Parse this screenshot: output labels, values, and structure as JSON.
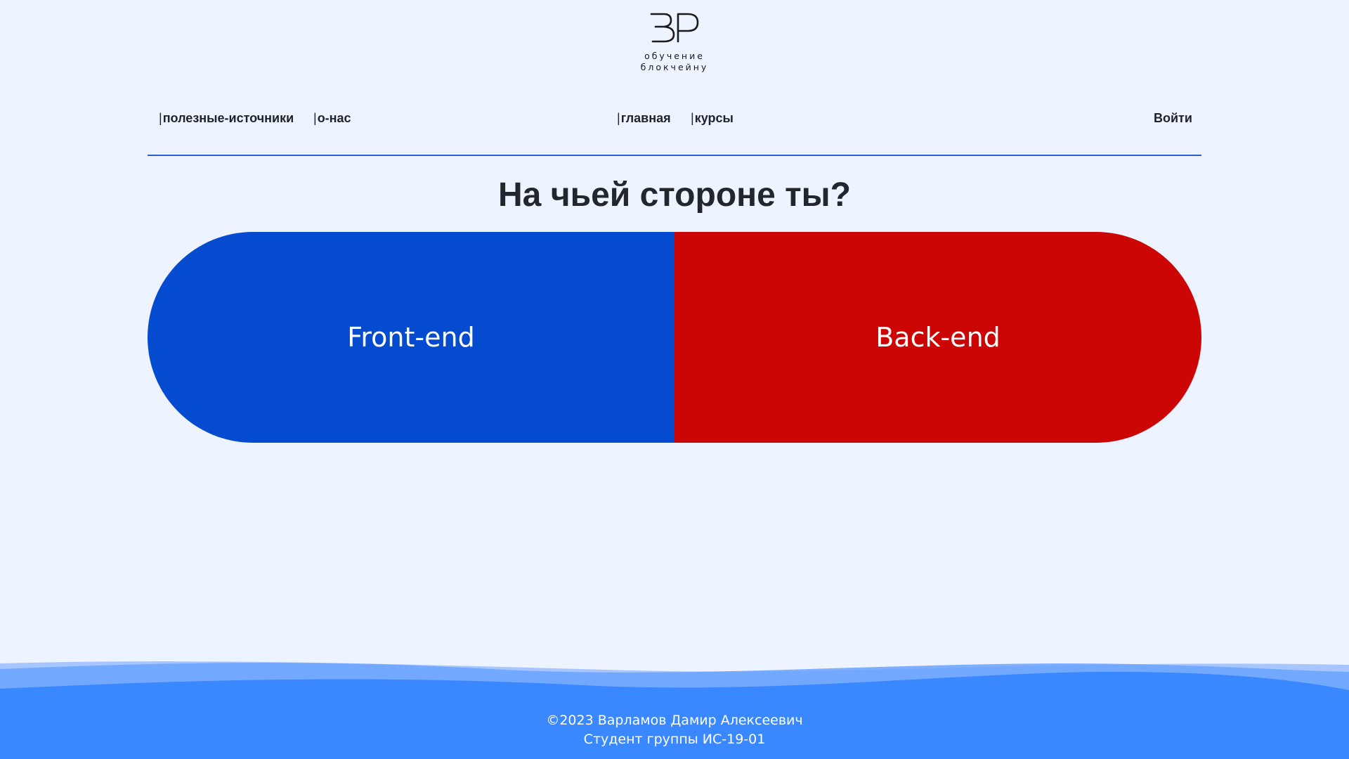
{
  "logo": {
    "line1": "обучение",
    "line2": "блокчейну"
  },
  "nav": {
    "links": [
      {
        "bar": "|",
        "label": "полезные-источники"
      },
      {
        "bar": "|",
        "label": "о-нас"
      },
      {
        "bar": "|",
        "label": "главная"
      },
      {
        "bar": "|",
        "label": "курсы"
      }
    ],
    "login": "Войти"
  },
  "main": {
    "headline": "На чьей стороне ты?",
    "choices": [
      {
        "label": "Front-end",
        "color": "#044bcf"
      },
      {
        "label": "Back-end",
        "color": "#cc0505"
      }
    ]
  },
  "footer": {
    "copyright": "©2023 Варламов Дамир Алексеевич",
    "group": "Студент группы ИС-19-01"
  },
  "colors": {
    "background": "#edf3ff",
    "accent": "#2f5fd6",
    "footer": "#3a88ff"
  }
}
